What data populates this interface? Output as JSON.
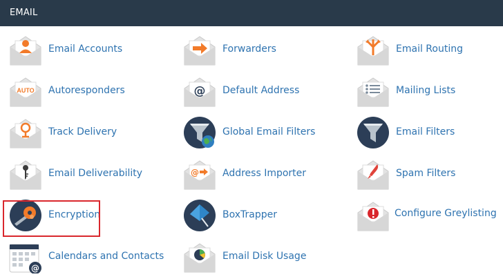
{
  "panel": {
    "title": "EMAIL"
  },
  "items": [
    {
      "label": "Email Accounts",
      "icon": "email-accounts-icon"
    },
    {
      "label": "Forwarders",
      "icon": "forwarders-icon"
    },
    {
      "label": "Email Routing",
      "icon": "email-routing-icon"
    },
    {
      "label": "Autoresponders",
      "icon": "autoresponders-icon",
      "icon_text": "AUTO"
    },
    {
      "label": "Default Address",
      "icon": "default-address-icon",
      "icon_text": "@"
    },
    {
      "label": "Mailing Lists",
      "icon": "mailing-lists-icon"
    },
    {
      "label": "Track Delivery",
      "icon": "track-delivery-icon"
    },
    {
      "label": "Global Email Filters",
      "icon": "global-email-filters-icon"
    },
    {
      "label": "Email Filters",
      "icon": "email-filters-icon"
    },
    {
      "label": "Email Deliverability",
      "icon": "email-deliverability-icon"
    },
    {
      "label": "Address Importer",
      "icon": "address-importer-icon",
      "icon_text": "@"
    },
    {
      "label": "Spam Filters",
      "icon": "spam-filters-icon"
    },
    {
      "label": "Encryption",
      "icon": "encryption-icon",
      "highlighted": true
    },
    {
      "label": "BoxTrapper",
      "icon": "boxtrapper-icon"
    },
    {
      "label": "Configure Greylisting",
      "icon": "configure-greylisting-icon"
    },
    {
      "label": "Calendars and Contacts",
      "icon": "calendars-and-contacts-icon",
      "icon_text": "@"
    },
    {
      "label": "Email Disk Usage",
      "icon": "email-disk-usage-icon"
    }
  ],
  "colors": {
    "header_bg": "#293a4a",
    "link": "#2e73b0",
    "envelope": "#e4e4e4",
    "accent_orange": "#f27b2a",
    "dark_circle": "#2c3e57",
    "highlight_border": "#d9262c"
  }
}
